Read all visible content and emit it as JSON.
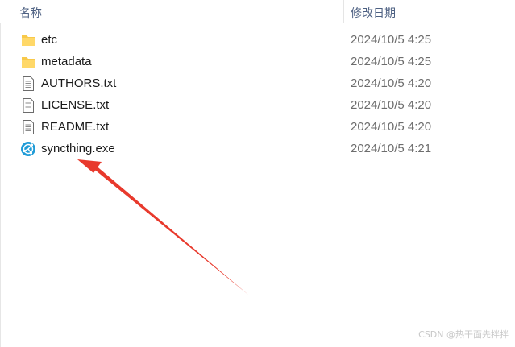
{
  "header": {
    "name_col": "名称",
    "date_col": "修改日期"
  },
  "files": [
    {
      "name": "etc",
      "date": "2024/10/5 4:25",
      "icon": "folder-icon"
    },
    {
      "name": "metadata",
      "date": "2024/10/5 4:25",
      "icon": "folder-icon"
    },
    {
      "name": "AUTHORS.txt",
      "date": "2024/10/5 4:20",
      "icon": "text-file-icon"
    },
    {
      "name": "LICENSE.txt",
      "date": "2024/10/5 4:20",
      "icon": "text-file-icon"
    },
    {
      "name": "README.txt",
      "date": "2024/10/5 4:20",
      "icon": "text-file-icon"
    },
    {
      "name": "syncthing.exe",
      "date": "2024/10/5 4:21",
      "icon": "syncthing-app-icon"
    }
  ],
  "annotation": {
    "arrow_color": "#e8392c"
  },
  "watermark": "CSDN @热干面先拌拌",
  "colors": {
    "header_text": "#4d6082",
    "folder": "#f8c94a",
    "syncthing": "#1e9bd7"
  }
}
